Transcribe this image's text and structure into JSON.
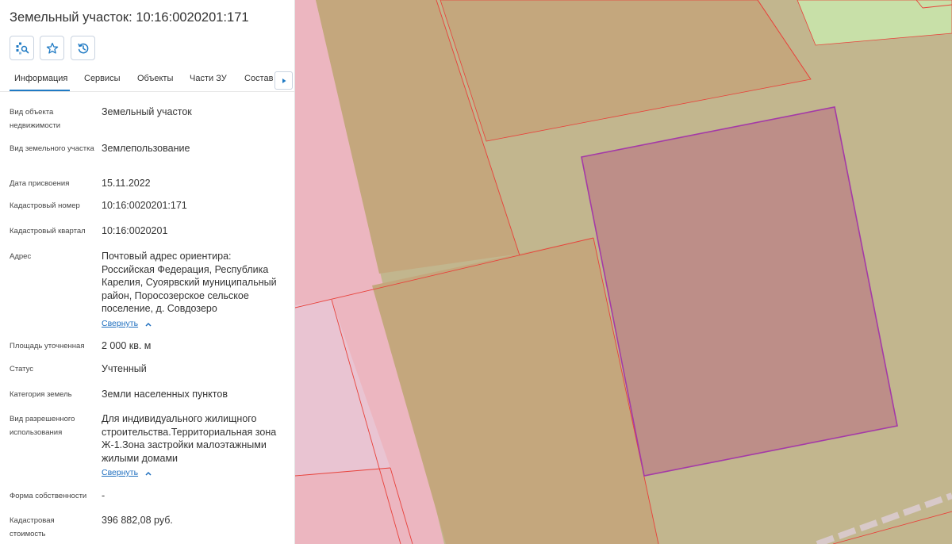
{
  "panel": {
    "title": "Земельный участок: 10:16:0020201:171",
    "tools": [
      {
        "name": "locate-on-map-icon"
      },
      {
        "name": "star-icon"
      },
      {
        "name": "history-icon"
      }
    ],
    "tabs": [
      {
        "label": "Информация",
        "active": true
      },
      {
        "label": "Сервисы"
      },
      {
        "label": "Объекты"
      },
      {
        "label": "Части ЗУ"
      },
      {
        "label": "Состав"
      }
    ],
    "collapse_label": "Свернуть",
    "fields": [
      {
        "label": "Вид объекта недвижимости",
        "value": "Земельный участок"
      },
      {
        "label": "Вид земельного участка",
        "value": "Землепользование"
      },
      {
        "label": "Дата присвоения",
        "value": "15.11.2022"
      },
      {
        "label": "Кадастровый номер",
        "value": "10:16:0020201:171"
      },
      {
        "label": "Кадастровый квартал",
        "value": "10:16:0020201"
      },
      {
        "label": "Адрес",
        "value": "Почтовый адрес ориентира: Российская Федерация, Республика Карелия, Суоярвский муниципальный район, Поросозерское сельское поселение, д. Совдозеро"
      },
      {
        "label": "Площадь уточненная",
        "value": "2 000 кв. м"
      },
      {
        "label": "Статус",
        "value": "Учтенный"
      },
      {
        "label": "Категория земель",
        "value": "Земли населенных пунктов"
      },
      {
        "label": "Вид разрешенного использования",
        "value": "Для индивидуального жилищного строительства.Территориальная зона Ж-1.Зона застройки малоэтажными жилыми домами"
      },
      {
        "label": "Форма собственности",
        "value": "-"
      },
      {
        "label": "Кадастровая стоимость",
        "value": "396 882,08 руб."
      }
    ]
  },
  "colors": {
    "accent": "#1f7ac4",
    "map_background": "#c2b68e",
    "parcel_fill": "#c4a77d",
    "selected_parcel_fill": "#bd8e88",
    "selected_parcel_border": "#a43aa7",
    "pink_zone": "#ecb6c0",
    "green_zone": "#c8e0a8",
    "boundary_line": "#e8413a"
  }
}
